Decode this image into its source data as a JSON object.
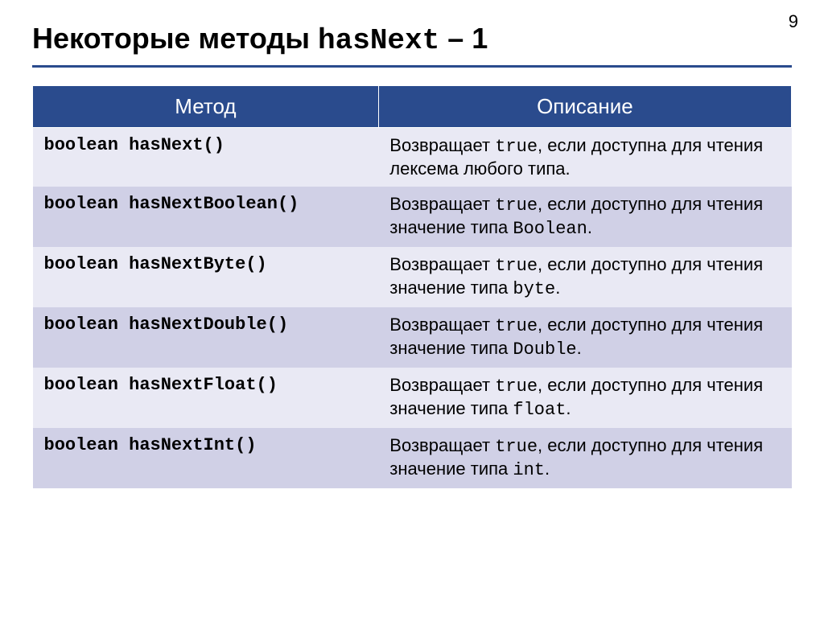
{
  "page_number": "9",
  "title": {
    "prefix": "Некоторые методы ",
    "code": "hasNext",
    "suffix": " – 1"
  },
  "header": {
    "col1": "Метод",
    "col2": "Описание"
  },
  "rows": [
    {
      "method": "boolean hasNext()",
      "desc_html": "Возвращает <span class=\"mono\">true</span>, если доступна для чтения лексема любого типа."
    },
    {
      "method": "boolean hasNextBoolean()",
      "desc_html": "Возвращает <span class=\"mono\">true</span>, если доступно для чтения значение типа <span class=\"mono\">Boolean</span>."
    },
    {
      "method": "boolean hasNextByte()",
      "desc_html": "Возвращает <span class=\"mono\">true</span>, если доступно для чтения значение типа <span class=\"mono\">byte</span>."
    },
    {
      "method": "boolean hasNextDouble()",
      "desc_html": "Возвращает <span class=\"mono\">true</span>, если доступно для чтения значение типа <span class=\"mono\">Double</span>."
    },
    {
      "method": "boolean hasNextFloat()",
      "desc_html": "Возвращает <span class=\"mono\">true</span>, если доступно для чтения значение типа <span class=\"mono\">float</span>."
    },
    {
      "method": "boolean hasNextInt()",
      "desc_html": "Возвращает <span class=\"mono\">true</span>, если доступно для чтения значение типа <span class=\"mono\">int</span>."
    }
  ]
}
